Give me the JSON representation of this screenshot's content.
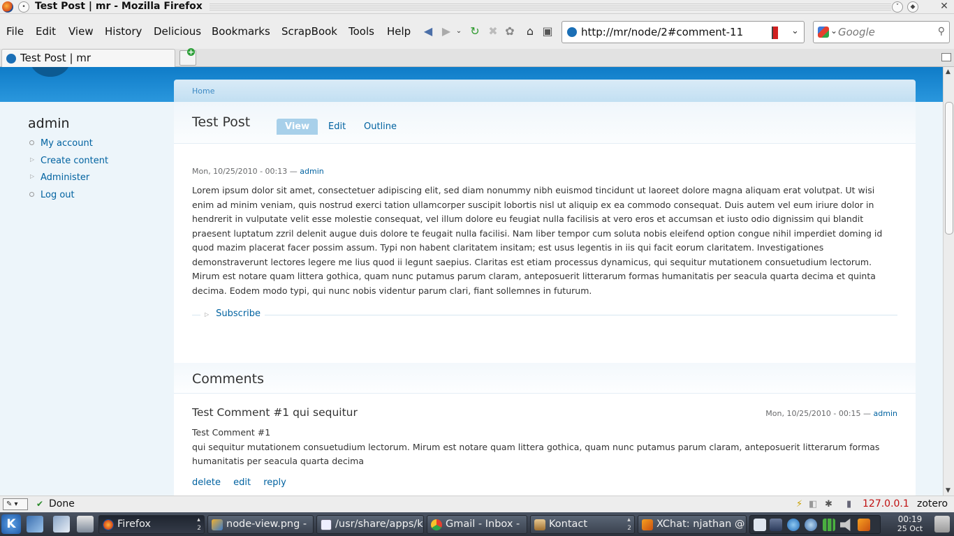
{
  "window": {
    "title": "Test Post | mr - Mozilla Firefox"
  },
  "menubar": {
    "items": [
      "File",
      "Edit",
      "View",
      "History",
      "Delicious",
      "Bookmarks",
      "ScrapBook",
      "Tools",
      "Help"
    ],
    "url": "http://mr/node/2#comment-11",
    "search_placeholder": "Google"
  },
  "tabs": [
    {
      "label": "Test Post | mr"
    }
  ],
  "page": {
    "sidebar": {
      "title": "admin",
      "links": [
        "My account",
        "Create content",
        "Administer",
        "Log out"
      ]
    },
    "breadcrumb": "Home",
    "node": {
      "title": "Test Post",
      "tabs": [
        "View",
        "Edit",
        "Outline"
      ],
      "active_tab": "View",
      "submitted_date": "Mon, 10/25/2010 - 00:13 — ",
      "submitted_author": "admin",
      "body": "Lorem ipsum dolor sit amet, consectetuer adipiscing elit, sed diam nonummy nibh euismod tincidunt ut laoreet dolore magna aliquam erat volutpat. Ut wisi enim ad minim veniam, quis nostrud exerci tation ullamcorper suscipit lobortis nisl ut aliquip ex ea commodo consequat. Duis autem vel eum iriure dolor in hendrerit in vulputate velit esse molestie consequat, vel illum dolore eu feugiat nulla facilisis at vero eros et accumsan et iusto odio dignissim qui blandit praesent luptatum zzril delenit augue duis dolore te feugait nulla facilisi. Nam liber tempor cum soluta nobis eleifend option congue nihil imperdiet doming id quod mazim placerat facer possim assum. Typi non habent claritatem insitam; est usus legentis in iis qui facit eorum claritatem. Investigationes demonstraverunt lectores legere me lius quod ii legunt saepius. Claritas est etiam processus dynamicus, qui sequitur mutationem consuetudium lectorum. Mirum est notare quam littera gothica, quam nunc putamus parum claram, anteposuerit litterarum formas humanitatis per seacula quarta decima et quinta decima. Eodem modo typi, qui nunc nobis videntur parum clari, fiant sollemnes in futurum.",
      "subscribe": "Subscribe"
    },
    "comments": {
      "heading": "Comments",
      "items": [
        {
          "title": "Test Comment #1 qui sequitur",
          "date": "Mon, 10/25/2010 - 00:15 — ",
          "author": "admin",
          "body_line1": "Test Comment #1",
          "body_line2": "qui sequitur mutationem consuetudium lectorum. Mirum est notare quam littera gothica, quam nunc putamus parum claram, anteposuerit litterarum formas humanitatis per seacula quarta decima",
          "links": [
            "delete",
            "edit",
            "reply"
          ]
        }
      ]
    }
  },
  "statusbar": {
    "status": "Done",
    "ip": "127.0.0.1",
    "zotero": "zotero"
  },
  "taskbar": {
    "tasks": [
      {
        "label": "Firefox",
        "count": "2"
      },
      {
        "label": "node-view.png -"
      },
      {
        "label": "/usr/share/apps/k"
      },
      {
        "label": "Gmail - Inbox -"
      },
      {
        "label": "Kontact",
        "count": "2"
      },
      {
        "label": "XChat: njathan @"
      }
    ],
    "clock_time": "00:19",
    "clock_date": "25 Oct"
  },
  "colors": {
    "link": "#0062a0",
    "header_blue": "#0f7cc8",
    "page_bg": "#edf5fa",
    "ip_red": "#c01010"
  }
}
